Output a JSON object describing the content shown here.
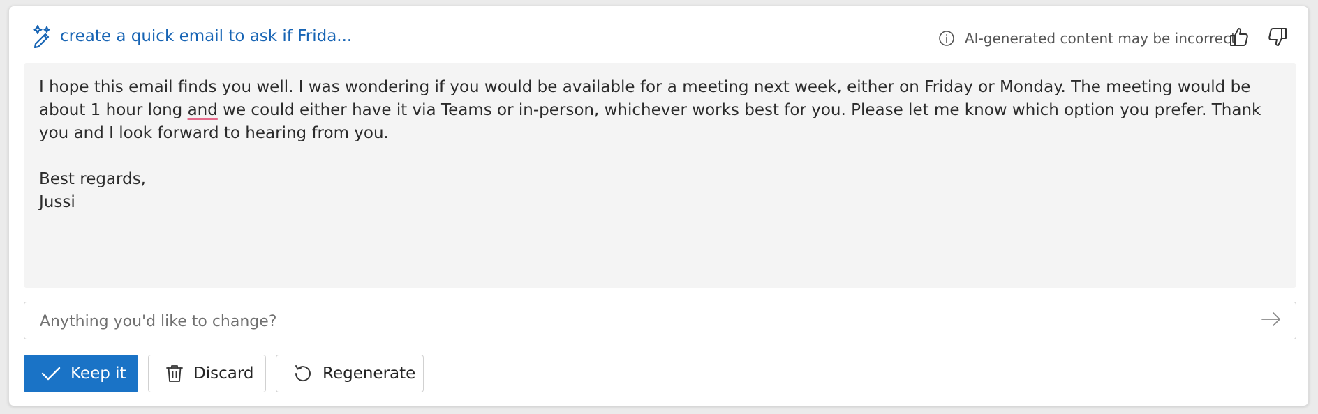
{
  "header": {
    "prompt_title": "create a quick email to ask if Frida...",
    "disclaimer": "AI-generated content may be incorrect",
    "icons": {
      "prompt": "pen-sparkle-icon",
      "info": "info-icon",
      "like": "thumbs-up-icon",
      "dislike": "thumbs-down-icon"
    }
  },
  "email": {
    "paragraph_part1": "I hope this email finds you well. I was wondering if you would be available for a meeting next week, either on Friday or Monday. The meeting would be about 1 hour long ",
    "flagged_word": "and",
    "paragraph_part2": " we could either have it via Teams or in-person, whichever works best for you. Please let me know which option you prefer. Thank you and I look forward to hearing from you.",
    "closing": "Best regards,",
    "signature": "Jussi"
  },
  "refine": {
    "placeholder": "Anything you'd like to change?",
    "value": "",
    "send_icon": "arrow-right-icon"
  },
  "actions": {
    "keep_label": "Keep it",
    "discard_label": "Discard",
    "regenerate_label": "Regenerate",
    "icons": {
      "keep": "checkmark-icon",
      "discard": "trash-icon",
      "regenerate": "refresh-icon"
    }
  },
  "colors": {
    "accent": "#1a73c6",
    "title_link": "#1764b4",
    "body_background": "#f4f4f4",
    "spellcheck_underline": "#e46b8b"
  }
}
